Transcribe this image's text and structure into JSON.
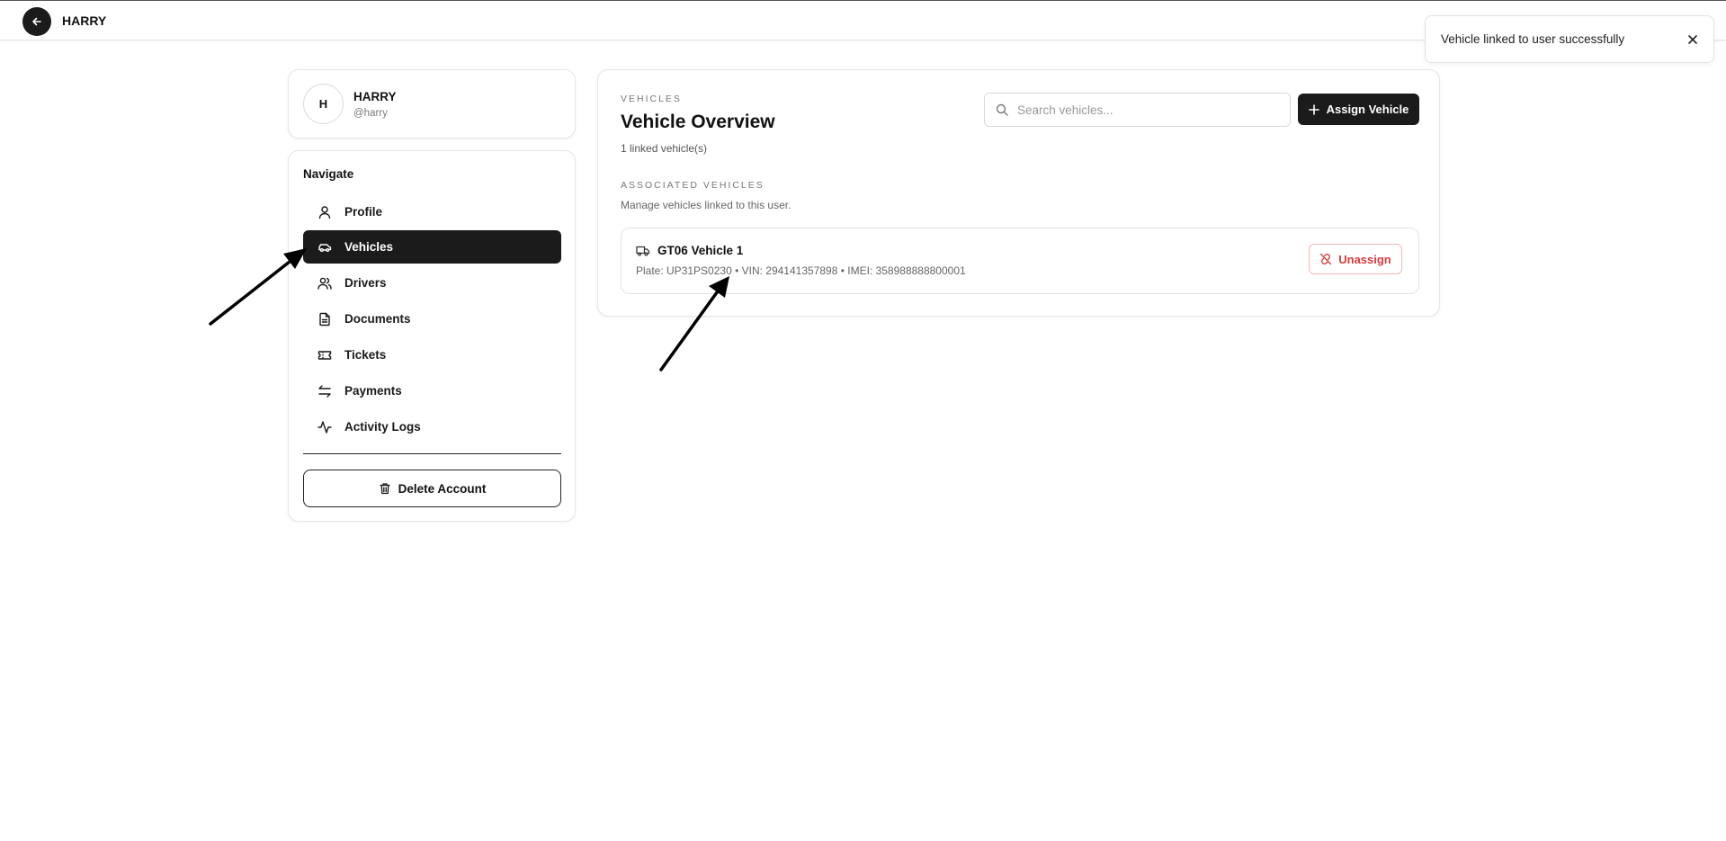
{
  "header": {
    "title": "HARRY",
    "back_icon": "arrow-left-icon"
  },
  "toast": {
    "message": "Vehicle linked to user successfully",
    "close_icon": "close-icon"
  },
  "profile": {
    "avatar_initial": "H",
    "name": "HARRY",
    "handle": "@harry"
  },
  "sidebar": {
    "heading": "Navigate",
    "items": [
      {
        "label": "Profile",
        "icon": "user-icon",
        "active": false
      },
      {
        "label": "Vehicles",
        "icon": "car-icon",
        "active": true
      },
      {
        "label": "Drivers",
        "icon": "users-icon",
        "active": false
      },
      {
        "label": "Documents",
        "icon": "document-icon",
        "active": false
      },
      {
        "label": "Tickets",
        "icon": "ticket-icon",
        "active": false
      },
      {
        "label": "Payments",
        "icon": "arrows-swap-icon",
        "active": false
      },
      {
        "label": "Activity Logs",
        "icon": "activity-icon",
        "active": false
      }
    ],
    "delete_label": "Delete Account"
  },
  "main": {
    "eyebrow": "VEHICLES",
    "title": "Vehicle Overview",
    "subtitle": "1 linked vehicle(s)",
    "search_placeholder": "Search vehicles...",
    "assign_label": "Assign Vehicle",
    "section_label": "ASSOCIATED VEHICLES",
    "section_desc": "Manage vehicles linked to this user.",
    "vehicles": [
      {
        "name": "GT06 Vehicle 1",
        "meta": "Plate: UP31PS0230 • VIN: 294141357898 • IMEI: 358988888800001",
        "unassign_label": "Unassign"
      }
    ]
  },
  "colors": {
    "primary_dark": "#1b1b1b",
    "danger": "#d93a3a",
    "border": "#e6e6e6"
  }
}
